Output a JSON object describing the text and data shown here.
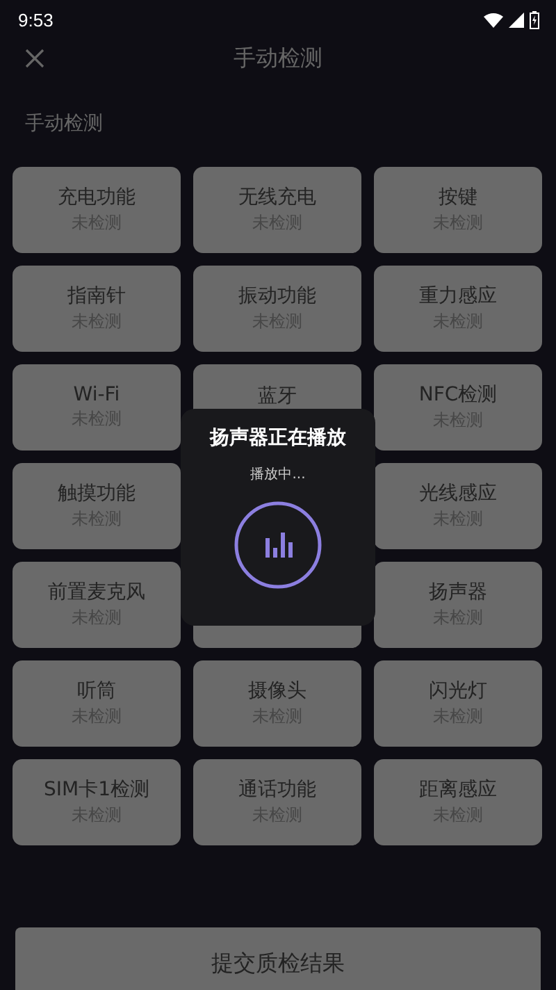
{
  "status_bar": {
    "time": "9:53"
  },
  "header": {
    "title": "手动检测"
  },
  "section": {
    "label": "手动检测"
  },
  "tests": [
    {
      "kind": "test",
      "name": "充电功能",
      "status": "未检测"
    },
    {
      "kind": "test",
      "name": "无线充电",
      "status": "未检测"
    },
    {
      "kind": "test",
      "name": "按键",
      "status": "未检测"
    },
    {
      "kind": "test",
      "name": "指南针",
      "status": "未检测"
    },
    {
      "kind": "test",
      "name": "振动功能",
      "status": "未检测"
    },
    {
      "kind": "test",
      "name": "重力感应",
      "status": "未检测"
    },
    {
      "kind": "test",
      "name": "Wi-Fi",
      "status": "未检测"
    },
    {
      "kind": "test",
      "name": "蓝牙"
    },
    {
      "kind": "test",
      "name": "NFC检测",
      "status": "未检测"
    },
    {
      "kind": "test",
      "name": "触摸功能",
      "status": "未检测"
    },
    {
      "kind": "hidden"
    },
    {
      "kind": "test",
      "name": "光线感应",
      "status": "未检测"
    },
    {
      "kind": "test",
      "name": "前置麦克风",
      "status": "未检测"
    },
    {
      "kind": "covered"
    },
    {
      "kind": "test",
      "name": "扬声器",
      "status": "未检测"
    },
    {
      "kind": "test",
      "name": "听筒",
      "status": "未检测"
    },
    {
      "kind": "test",
      "name": "摄像头",
      "status": "未检测"
    },
    {
      "kind": "test",
      "name": "闪光灯",
      "status": "未检测"
    },
    {
      "kind": "test",
      "name": "SIM卡1检测",
      "status": "未检测"
    },
    {
      "kind": "test",
      "name": "通话功能",
      "status": "未检测"
    },
    {
      "kind": "test",
      "name": "距离感应",
      "status": "未检测"
    }
  ],
  "submit_button": {
    "label": "提交质检结果"
  },
  "toast": {
    "title": "扬声器正在播放",
    "message": "播放中..."
  }
}
